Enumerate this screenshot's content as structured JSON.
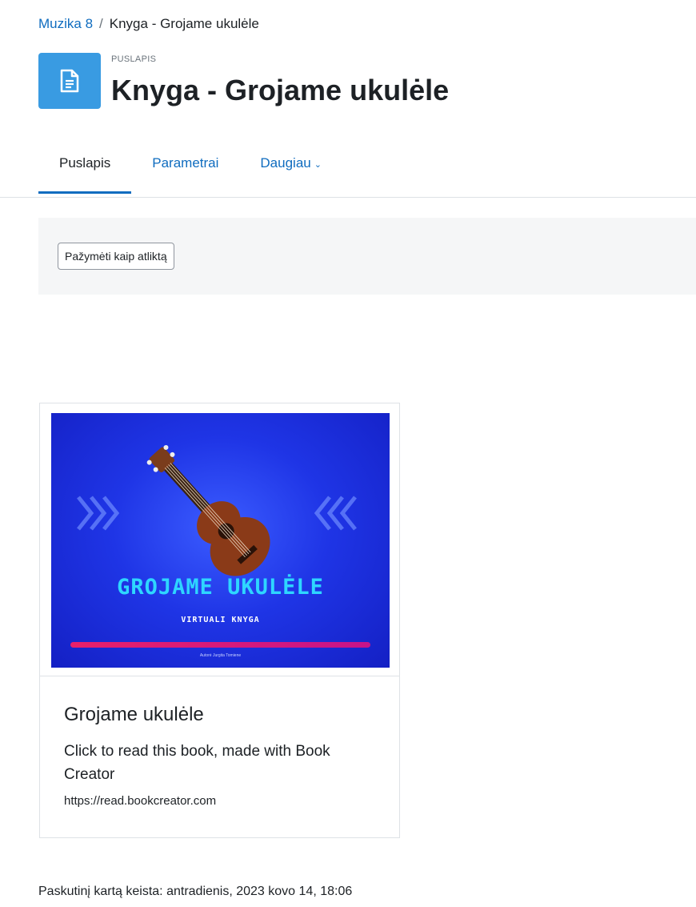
{
  "breadcrumb": {
    "course": "Muzika 8",
    "separator": "/",
    "current": "Knyga - Grojame ukulėle"
  },
  "header": {
    "type_label": "PUSLAPIS",
    "title": "Knyga - Grojame ukulėle",
    "icon": "page-icon"
  },
  "tabs": [
    {
      "label": "Puslapis",
      "active": true
    },
    {
      "label": "Parametrai",
      "active": false
    },
    {
      "label": "Daugiau",
      "active": false,
      "icon": "chevron-down-icon"
    }
  ],
  "activity": {
    "mark_done_label": "Pažymėti kaip atliktą"
  },
  "card": {
    "cover": {
      "title": "GROJAME UKULĖLE",
      "subtitle": "VIRTUALI KNYGA",
      "author": "Autorė Jurgita Tomiene"
    },
    "title": "Grojame ukulėle",
    "description": "Click to read this book, made with Book Creator",
    "url": "https://read.bookcreator.com"
  },
  "footer": {
    "last_modified": "Paskutinį kartą keista: antradienis, 2023 kovo 14, 18:06"
  },
  "colors": {
    "link": "#0f6cbf",
    "page_icon_bg": "#399be2",
    "cover_title": "#2ed6ff",
    "cover_bar": "#e8206a"
  }
}
